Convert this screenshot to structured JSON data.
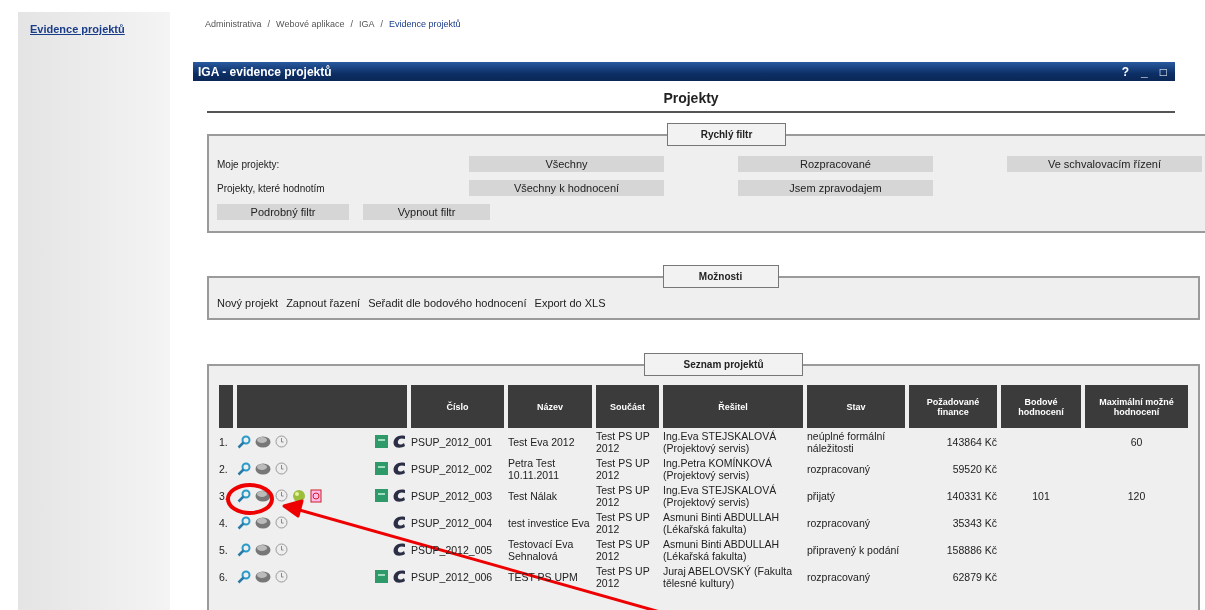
{
  "sidebar": {
    "link": "Evidence projektů"
  },
  "breadcrumb": {
    "separator": "/",
    "items": [
      "Administrativa",
      "Webové aplikace",
      "IGA",
      "Evidence projektů"
    ]
  },
  "window": {
    "title": "IGA - evidence projektů",
    "controls": [
      "?",
      "_",
      "□"
    ]
  },
  "heading": "Projekty",
  "quick_filter": {
    "legend": "Rychlý filtr",
    "rows": [
      {
        "label": "Moje projekty:",
        "buttons": [
          "Všechny",
          "Rozpracované",
          "Ve schvalovacím řízení"
        ]
      },
      {
        "label": "Projekty, které hodnotím",
        "buttons": [
          "Všechny k hodnocení",
          "Jsem zpravodajem"
        ]
      }
    ],
    "buttons": [
      "Podrobný filtr",
      "Vypnout filtr"
    ]
  },
  "options": {
    "legend": "Možnosti",
    "links": [
      "Nový projekt",
      "Zapnout řazení",
      "Seřadit dle bodového hodnocení",
      "Export do XLS"
    ]
  },
  "projects": {
    "legend": "Seznam projektů",
    "columns": [
      "Číslo",
      "Název",
      "Součást",
      "Řešitel",
      "Stav",
      "Požadované finance",
      "Bodové hodnocení",
      "Maximální možné hodnocení"
    ],
    "rows": [
      {
        "index": "1.",
        "green_icon": true,
        "extra_icons": false,
        "number": "PSUP_2012_001",
        "name": "Test Eva 2012",
        "part": "Test PS UP 2012",
        "researcher": "Ing.Eva STEJSKALOVÁ (Projektový servis)",
        "state": "neúplné formální náležitosti",
        "finance": "143864 Kč",
        "max_score": "60"
      },
      {
        "index": "2.",
        "green_icon": true,
        "extra_icons": false,
        "number": "PSUP_2012_002",
        "name": "Petra Test 10.11.2011",
        "part": "Test PS UP 2012",
        "researcher": "Ing.Petra KOMÍNKOVÁ (Projektový servis)",
        "state": "rozpracovaný",
        "finance": "59520 Kč"
      },
      {
        "index": "3.",
        "green_icon": true,
        "extra_icons": true,
        "number": "PSUP_2012_003",
        "name": "Test Nálak",
        "part": "Test PS UP 2012",
        "researcher": "Ing.Eva STEJSKALOVÁ (Projektový servis)",
        "state": "přijatý",
        "finance": "140331 Kč",
        "score": "101",
        "max_score": "120"
      },
      {
        "index": "4.",
        "green_icon": false,
        "extra_icons": false,
        "number": "PSUP_2012_004",
        "name": "test investice Eva",
        "part": "Test PS UP 2012",
        "researcher": "Asmuni Binti ABDULLAH (Lékařská fakulta)",
        "state": "rozpracovaný",
        "finance": "35343 Kč"
      },
      {
        "index": "5.",
        "green_icon": false,
        "extra_icons": false,
        "number": "PSUP_2012_005",
        "name": "Testovací Eva Sehnalová",
        "part": "Test PS UP 2012",
        "researcher": "Asmuni Binti ABDULLAH (Lékařská fakulta)",
        "state": "připravený k podání",
        "finance": "158886 Kč"
      },
      {
        "index": "6.",
        "green_icon": true,
        "extra_icons": false,
        "number": "PSUP_2012_006",
        "name": "TEST PS UPM",
        "part": "Test PS UP 2012",
        "researcher": "Juraj ABELOVSKÝ (Fakulta tělesné kultury)",
        "state": "rozpracovaný",
        "finance": "62879 Kč"
      }
    ]
  }
}
